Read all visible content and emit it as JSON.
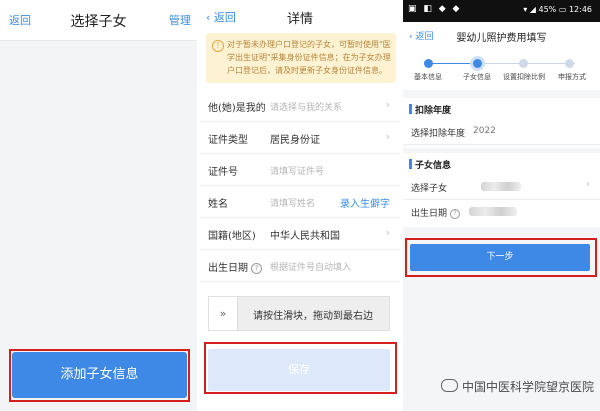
{
  "panel1": {
    "back": "返回",
    "title": "选择子女",
    "manage": "管理",
    "add_button": "添加子女信息"
  },
  "panel2": {
    "back": "返回",
    "title": "详情",
    "notice": "对于暂未办理户口登记的子女，可暂时使用\"医学出生证明\"采集身份证件信息；在为子女办理户口登记后，请及时更新子女身份证件信息。",
    "rows": [
      {
        "label": "他(她)是我的",
        "placeholder": "请选择与我的关系"
      },
      {
        "label": "证件类型",
        "value": "居民身份证"
      },
      {
        "label": "证件号",
        "placeholder": "请填写证件号"
      },
      {
        "label": "姓名",
        "placeholder": "请填写姓名",
        "link": "录入生僻字"
      },
      {
        "label": "国籍(地区)",
        "value": "中华人民共和国"
      },
      {
        "label": "出生日期",
        "placeholder": "根据证件号自动填入"
      }
    ],
    "slider_hint": "请按住滑块，拖动到最右边",
    "slider_knob": "»",
    "save_button": "保存"
  },
  "panel3": {
    "status_battery": "45%",
    "status_time": "12:46",
    "back": "返回",
    "title": "婴幼儿照护费用填写",
    "steps": [
      "基本信息",
      "子女信息",
      "设置扣除比例",
      "申报方式"
    ],
    "current_step": 1,
    "section_deduct_year": "扣除年度",
    "deduct_year_label": "选择扣除年度",
    "deduct_year_value": "2022",
    "section_child_info": "子女信息",
    "child_label": "选择子女",
    "birth_label": "出生日期",
    "next_button": "下一步"
  },
  "watermark": "中国中医科学院望京医院",
  "colors": {
    "accent": "#3e88e6",
    "highlight": "#d3201c",
    "notice_bg": "#fdf3d3",
    "notice_text": "#b8843a"
  }
}
